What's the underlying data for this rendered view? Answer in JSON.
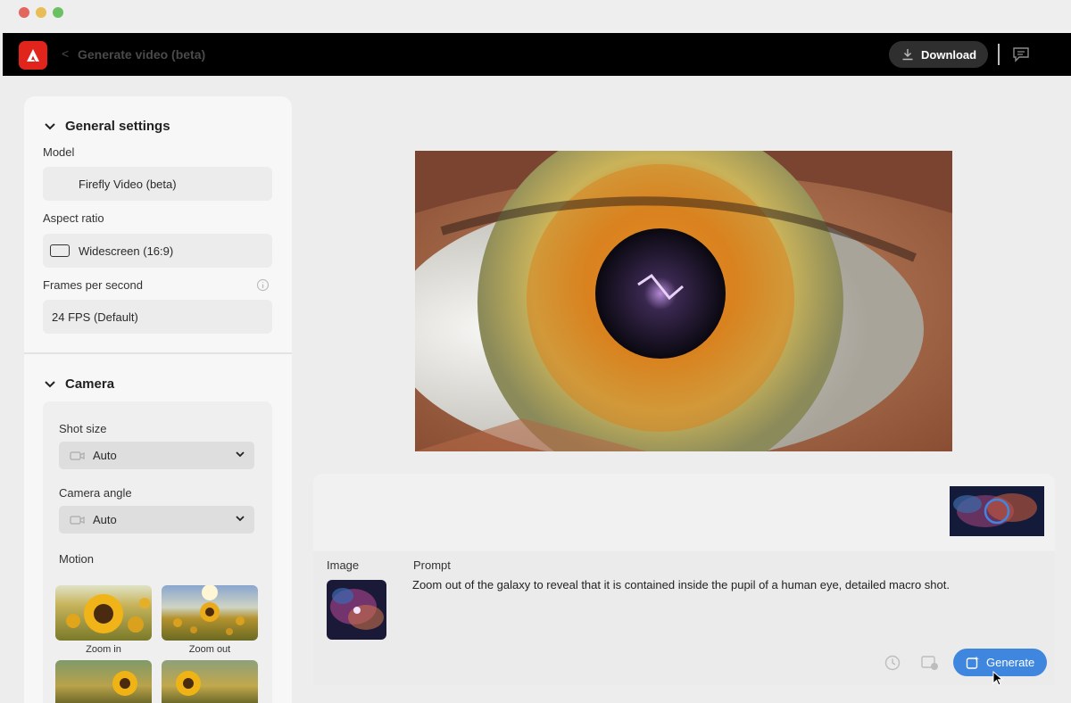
{
  "app": {
    "back_symbol": "<",
    "title": "Generate video (beta)",
    "download_label": "Download"
  },
  "general": {
    "heading": "General settings",
    "model_label": "Model",
    "model_value": "Firefly Video (beta)",
    "aspect_label": "Aspect ratio",
    "aspect_value": "Widescreen (16:9)",
    "fps_label": "Frames per second",
    "fps_value": "24 FPS (Default)"
  },
  "camera": {
    "heading": "Camera",
    "shot_size_label": "Shot size",
    "shot_size_value": "Auto",
    "camera_angle_label": "Camera angle",
    "camera_angle_value": "Auto",
    "motion_label": "Motion",
    "motion_items": [
      "Zoom in",
      "Zoom out"
    ]
  },
  "prompt": {
    "image_label": "Image",
    "prompt_label": "Prompt",
    "prompt_text": "Zoom out of the galaxy to reveal that it is contained inside the pupil of a human eye, detailed macro shot.",
    "generate_label": "Generate"
  },
  "colors": {
    "accent": "#3f86df",
    "brand": "#e2251c"
  }
}
